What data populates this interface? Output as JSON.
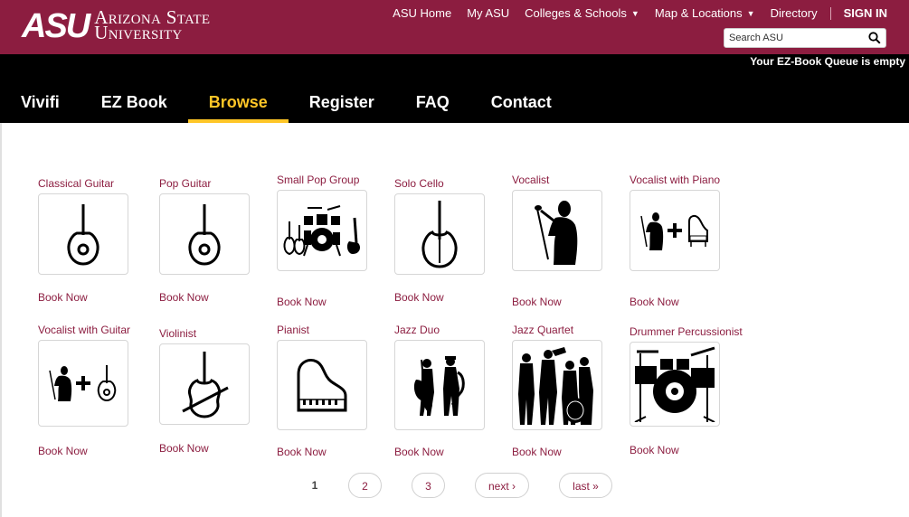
{
  "header": {
    "logo_mark": "ASU",
    "logo_line1": "Arizona State",
    "logo_line2": "University",
    "top_links": [
      {
        "label": "ASU Home"
      },
      {
        "label": "My ASU"
      },
      {
        "label": "Colleges & Schools",
        "dropdown": true
      },
      {
        "label": "Map & Locations",
        "dropdown": true
      },
      {
        "label": "Directory"
      }
    ],
    "sign_in": "SIGN IN",
    "search_placeholder": "Search ASU",
    "search_icon": "search-icon"
  },
  "queue_status": "Your EZ-Book Queue is empty",
  "main_nav": [
    {
      "label": "Vivifi"
    },
    {
      "label": "EZ Book"
    },
    {
      "label": "Browse",
      "active": true
    },
    {
      "label": "Register"
    },
    {
      "label": "FAQ"
    },
    {
      "label": "Contact"
    }
  ],
  "cards": [
    {
      "title": "Classical Guitar",
      "icon": "guitar-icon",
      "action": "Book Now"
    },
    {
      "title": "Pop Guitar",
      "icon": "guitar-icon",
      "action": "Book Now"
    },
    {
      "title": "Small Pop Group",
      "icon": "band-icon",
      "action": "Book Now"
    },
    {
      "title": "Solo Cello",
      "icon": "cello-icon",
      "action": "Book Now"
    },
    {
      "title": "Vocalist",
      "icon": "singer-icon",
      "action": "Book Now"
    },
    {
      "title": "Vocalist with Piano",
      "icon": "singer-plus-piano-icon",
      "action": "Book Now"
    },
    {
      "title": "Vocalist with Guitar",
      "icon": "singer-plus-guitar-icon",
      "action": "Book Now"
    },
    {
      "title": "Violinist",
      "icon": "violin-icon",
      "action": "Book Now"
    },
    {
      "title": "Pianist",
      "icon": "grand-piano-icon",
      "action": "Book Now"
    },
    {
      "title": "Jazz Duo",
      "icon": "jazz-duo-icon",
      "action": "Book Now"
    },
    {
      "title": "Jazz Quartet",
      "icon": "jazz-quartet-icon",
      "action": "Book Now"
    },
    {
      "title": "Drummer Percussionist",
      "icon": "drum-kit-icon",
      "action": "Book Now"
    }
  ],
  "pagination": {
    "current": "1",
    "pages": [
      "2",
      "3"
    ],
    "next": "next ›",
    "last": "last »"
  },
  "colors": {
    "maroon": "#8c1d40",
    "gold": "#ffc627",
    "black": "#000000"
  }
}
